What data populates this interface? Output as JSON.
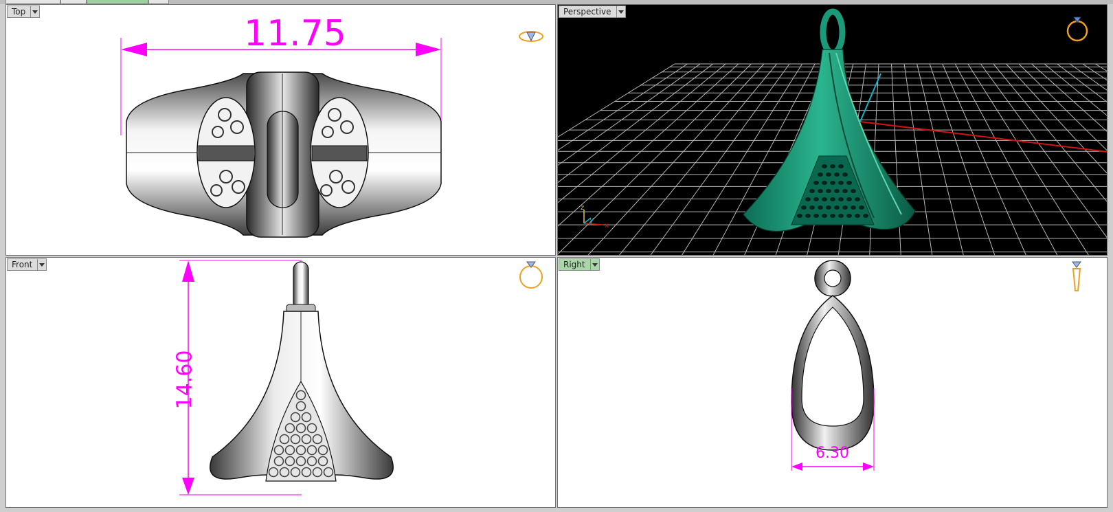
{
  "viewports": {
    "top": {
      "label": "Top",
      "dimension": "11.75"
    },
    "perspective": {
      "label": "Perspective",
      "axis": {
        "z": "z",
        "y": "y",
        "x": "x"
      }
    },
    "front": {
      "label": "Front",
      "dimension": "14.60"
    },
    "right": {
      "label": "Right",
      "dimension": "6.30"
    }
  },
  "colors": {
    "dimension": "#ff00ff",
    "model_green": "#1a9a78",
    "grid": "#d9d9d9",
    "x_axis": "#d01414",
    "y_axis": "#10b4c4",
    "active_tab": "#a9d7a9",
    "gumball_orange": "#f0a020"
  },
  "icons": [
    "dropdown-arrow-icon",
    "ring-icon",
    "diamond-icon",
    "axis-triad-icon"
  ]
}
